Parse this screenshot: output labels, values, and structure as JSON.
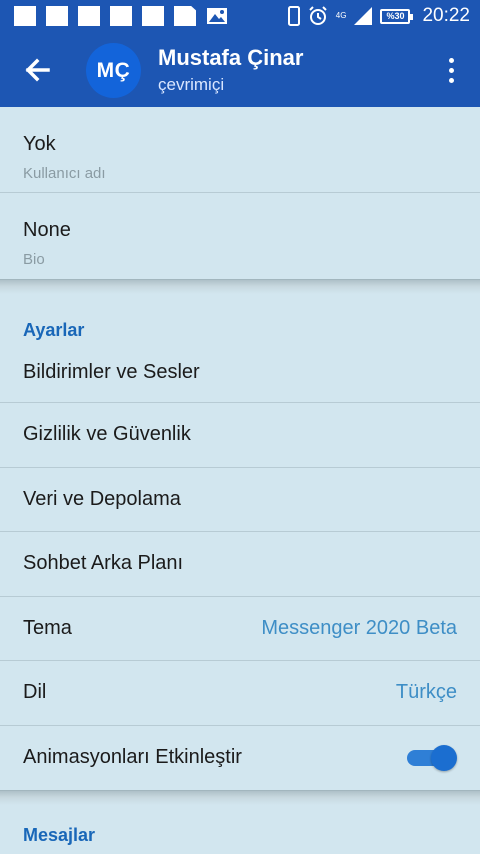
{
  "status_bar": {
    "time": "20:22",
    "battery": "%30",
    "network": "4G"
  },
  "header": {
    "avatar_initials": "MÇ",
    "name": "Mustafa Çinar",
    "status": "çevrimiçi"
  },
  "profile": {
    "username_value": "Yok",
    "username_label": "Kullanıcı adı",
    "bio_value": "None",
    "bio_label": "Bio"
  },
  "settings": {
    "title": "Ayarlar",
    "items": [
      {
        "label": "Bildirimler ve Sesler"
      },
      {
        "label": "Gizlilik ve Güvenlik"
      },
      {
        "label": "Veri ve Depolama"
      },
      {
        "label": "Sohbet Arka Planı"
      },
      {
        "label": "Tema",
        "value": "Messenger 2020 Beta"
      },
      {
        "label": "Dil",
        "value": "Türkçe"
      },
      {
        "label": "Animasyonları Etkinleştir",
        "toggle": true
      }
    ]
  },
  "next_section": {
    "title": "Mesajlar"
  },
  "colors": {
    "primary": "#1d56b3",
    "accent": "#1967b8",
    "background": "#d2e6ef",
    "value_text": "#3e8ec6"
  }
}
